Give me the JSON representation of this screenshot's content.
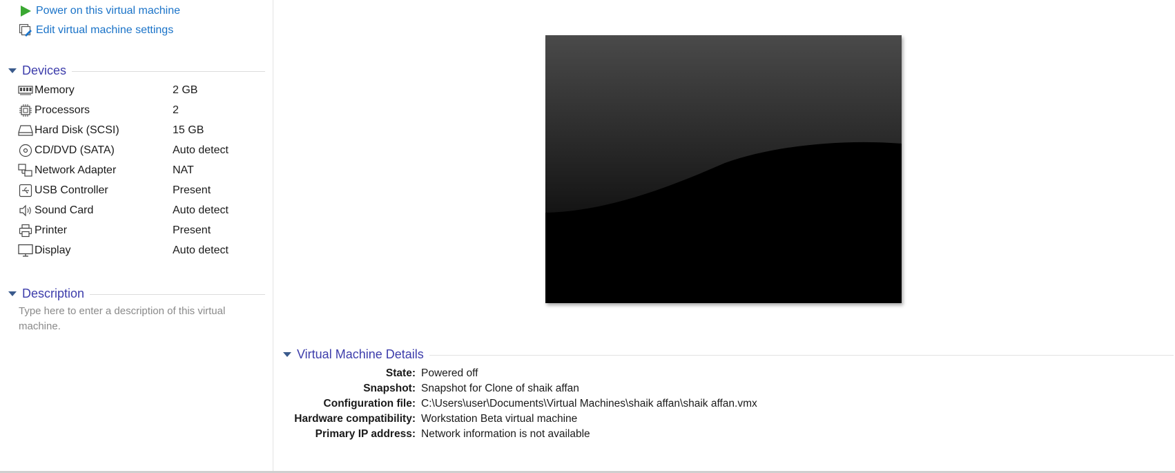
{
  "commands": {
    "power_on": "Power on this virtual machine",
    "edit_settings": "Edit virtual machine settings"
  },
  "devices": {
    "title": "Devices",
    "items": [
      {
        "name": "Memory",
        "value": "2 GB",
        "icon": "memory-icon"
      },
      {
        "name": "Processors",
        "value": "2",
        "icon": "processor-icon"
      },
      {
        "name": "Hard Disk (SCSI)",
        "value": "15 GB",
        "icon": "hard-disk-icon"
      },
      {
        "name": "CD/DVD (SATA)",
        "value": "Auto detect",
        "icon": "cd-dvd-icon"
      },
      {
        "name": "Network Adapter",
        "value": "NAT",
        "icon": "network-adapter-icon"
      },
      {
        "name": "USB Controller",
        "value": "Present",
        "icon": "usb-icon"
      },
      {
        "name": "Sound Card",
        "value": "Auto detect",
        "icon": "speaker-icon"
      },
      {
        "name": "Printer",
        "value": "Present",
        "icon": "printer-icon"
      },
      {
        "name": "Display",
        "value": "Auto detect",
        "icon": "monitor-icon"
      }
    ]
  },
  "description": {
    "title": "Description",
    "placeholder": "Type here to enter a description of this virtual machine."
  },
  "details": {
    "title": "Virtual Machine Details",
    "rows": [
      {
        "label": "State:",
        "value": "Powered off"
      },
      {
        "label": "Snapshot:",
        "value": "Snapshot for Clone of shaik affan"
      },
      {
        "label": "Configuration file:",
        "value": "C:\\Users\\user\\Documents\\Virtual Machines\\shaik affan\\shaik affan.vmx"
      },
      {
        "label": "Hardware compatibility:",
        "value": "Workstation Beta virtual machine"
      },
      {
        "label": "Primary IP address:",
        "value": "Network information is not available"
      }
    ]
  },
  "colors": {
    "link": "#1a73c8",
    "section_title": "#3d3dab",
    "power_icon": "#3aa832"
  }
}
